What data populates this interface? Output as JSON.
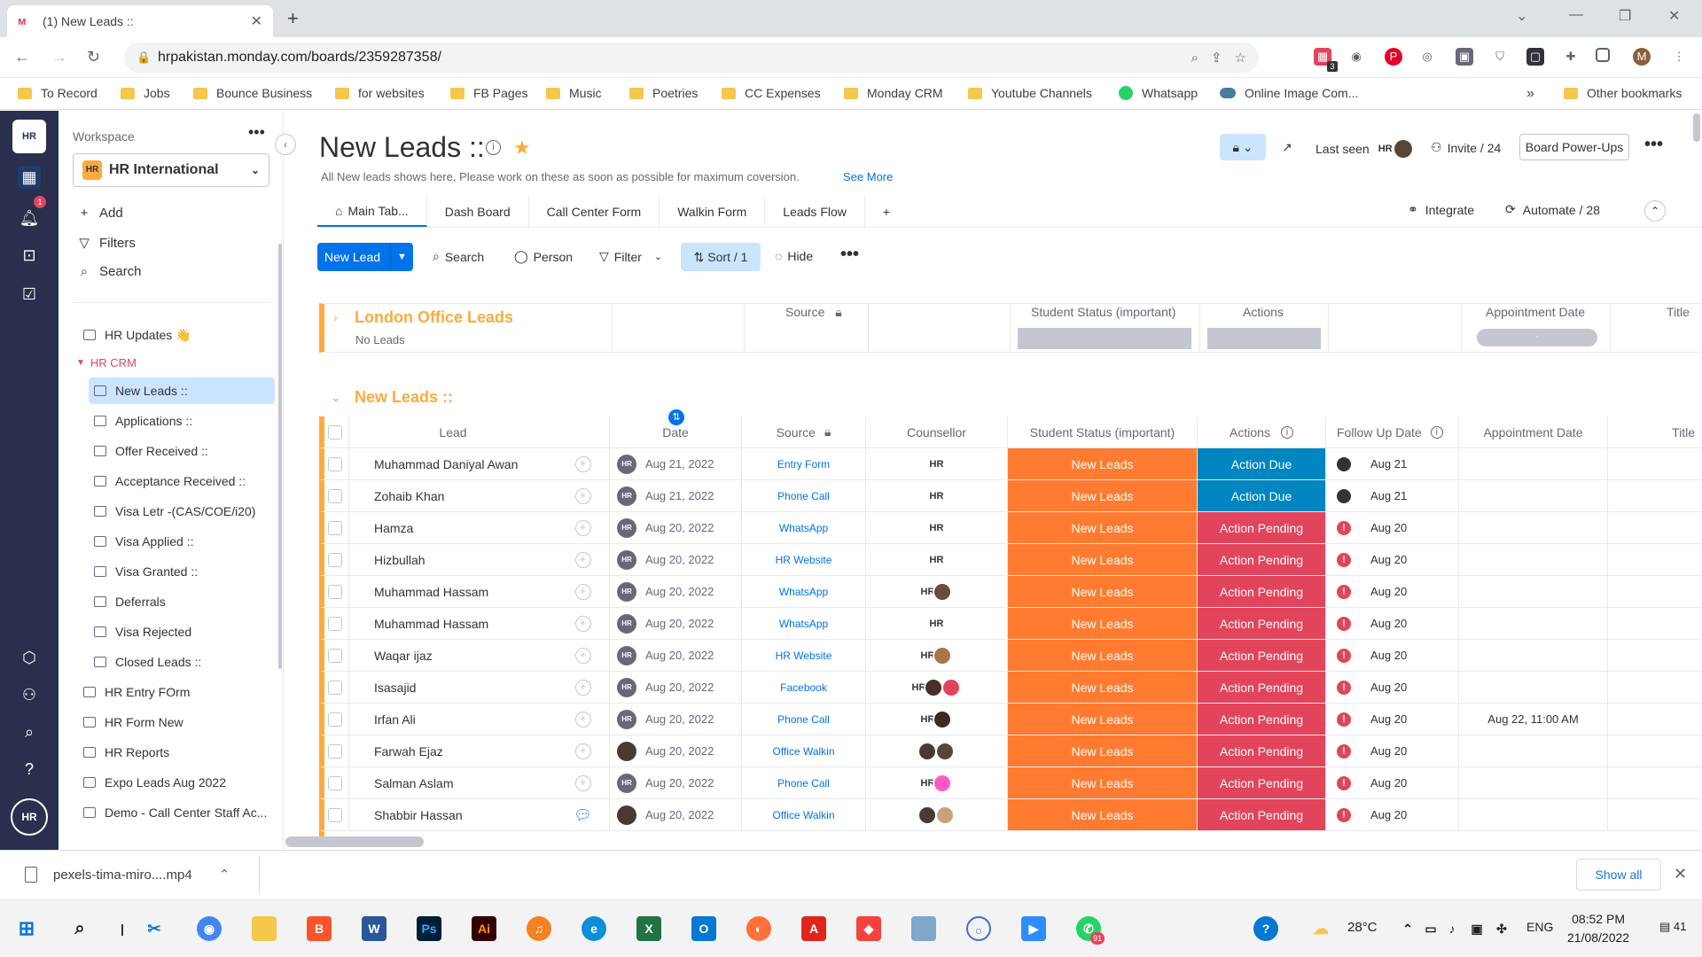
{
  "browser": {
    "tab_title": "(1) New Leads ::",
    "url": "hrpakistan.monday.com/boards/2359287358/",
    "bookmarks": [
      "To Record",
      "Jobs",
      "Bounce Business",
      "for websites",
      "FB Pages",
      "Music",
      "Poetries",
      "CC Expenses",
      "Monday CRM",
      "Youtube Channels",
      "Whatsapp",
      "Online Image Com...",
      "Other bookmarks"
    ],
    "ext_badge": "3"
  },
  "rail": {
    "notif_count": "1"
  },
  "sidebar": {
    "workspace_label": "Workspace",
    "workspace_name": "HR International",
    "workspace_badge": "HR",
    "add": "Add",
    "filters": "Filters",
    "search": "Search",
    "items": [
      {
        "label": "HR Updates 👋"
      },
      {
        "label": "HR CRM"
      },
      {
        "label": "New Leads ::"
      },
      {
        "label": "Applications ::"
      },
      {
        "label": "Offer Received ::"
      },
      {
        "label": "Acceptance Received ::"
      },
      {
        "label": "Visa Letr -(CAS/COE/i20)"
      },
      {
        "label": "Visa Applied ::"
      },
      {
        "label": "Visa Granted ::"
      },
      {
        "label": "Deferrals"
      },
      {
        "label": "Visa Rejected"
      },
      {
        "label": "Closed Leads ::"
      },
      {
        "label": "HR Entry FOrm"
      },
      {
        "label": "HR Form New"
      },
      {
        "label": "HR Reports"
      },
      {
        "label": "Expo Leads Aug 2022"
      },
      {
        "label": "Demo - Call Center Staff Ac..."
      }
    ]
  },
  "board": {
    "title": "New Leads ::",
    "description": "All New leads shows here, Please work on these as soon as possible for maximum coversion.",
    "see_more": "See More",
    "last_seen": "Last seen",
    "invite": "Invite / 24",
    "powerups": "Board Power-Ups",
    "views": [
      "Main Tab...",
      "Dash Board",
      "Call Center Form",
      "Walkin Form",
      "Leads Flow"
    ],
    "integrate": "Integrate",
    "automate": "Automate / 28"
  },
  "toolbar": {
    "new_lead": "New Lead",
    "search": "Search",
    "person": "Person",
    "filter": "Filter",
    "sort": "Sort / 1",
    "hide": "Hide"
  },
  "group1": {
    "title": "London Office Leads",
    "subtitle": "No Leads",
    "columns": {
      "source": "Source",
      "status": "Student Status (important)",
      "actions": "Actions",
      "appointment": "Appointment Date",
      "title": "Title"
    },
    "appointment_placeholder": "-"
  },
  "group2": {
    "title": "New Leads ::",
    "columns": {
      "lead": "Lead",
      "date": "Date",
      "source": "Source",
      "counsellor": "Counsellor",
      "status": "Student Status (important)",
      "actions": "Actions",
      "followup": "Follow Up Date",
      "appointment": "Appointment Date",
      "title": "Title"
    }
  },
  "colors": {
    "status_new": "#ff7b31",
    "action_due": "#0086c0",
    "action_pending": "#e2445c",
    "group_accent": "#fdab3d"
  },
  "rows": [
    {
      "lead": "Muhammad Daniyal Awan",
      "date": "Aug 21, 2022",
      "source": "Entry Form",
      "counsellor": "HR",
      "status": "New Leads",
      "action": "Action Due",
      "followup": "Aug 21",
      "appointment": ""
    },
    {
      "lead": "Zohaib Khan",
      "date": "Aug 21, 2022",
      "source": "Phone Call",
      "counsellor": "HR",
      "status": "New Leads",
      "action": "Action Due",
      "followup": "Aug 21",
      "appointment": ""
    },
    {
      "lead": "Hamza",
      "date": "Aug 20, 2022",
      "source": "WhatsApp",
      "counsellor": "HR",
      "status": "New Leads",
      "action": "Action Pending",
      "followup": "Aug 20",
      "appointment": ""
    },
    {
      "lead": "Hizbullah",
      "date": "Aug 20, 2022",
      "source": "HR Website",
      "counsellor": "HR",
      "status": "New Leads",
      "action": "Action Pending",
      "followup": "Aug 20",
      "appointment": ""
    },
    {
      "lead": "Muhammad Hassam",
      "date": "Aug 20, 2022",
      "source": "WhatsApp",
      "counsellor": "HR",
      "status": "New Leads",
      "action": "Action Pending",
      "followup": "Aug 20",
      "appointment": ""
    },
    {
      "lead": "Muhammad Hassam",
      "date": "Aug 20, 2022",
      "source": "WhatsApp",
      "counsellor": "HR",
      "status": "New Leads",
      "action": "Action Pending",
      "followup": "Aug 20",
      "appointment": ""
    },
    {
      "lead": "Waqar ijaz",
      "date": "Aug 20, 2022",
      "source": "HR Website",
      "counsellor": "HR",
      "status": "New Leads",
      "action": "Action Pending",
      "followup": "Aug 20",
      "appointment": ""
    },
    {
      "lead": "Isasajid",
      "date": "Aug 20, 2022",
      "source": "Facebook",
      "counsellor": "HR",
      "status": "New Leads",
      "action": "Action Pending",
      "followup": "Aug 20",
      "appointment": ""
    },
    {
      "lead": "Irfan Ali",
      "date": "Aug 20, 2022",
      "source": "Phone Call",
      "counsellor": "HR",
      "status": "New Leads",
      "action": "Action Pending",
      "followup": "Aug 20",
      "appointment": "Aug 22, 11:00 AM"
    },
    {
      "lead": "Farwah Ejaz",
      "date": "Aug 20, 2022",
      "source": "Office Walkin",
      "counsellor": "",
      "status": "New Leads",
      "action": "Action Pending",
      "followup": "Aug 20",
      "appointment": ""
    },
    {
      "lead": "Salman Aslam",
      "date": "Aug 20, 2022",
      "source": "Phone Call",
      "counsellor": "HR",
      "status": "New Leads",
      "action": "Action Pending",
      "followup": "Aug 20",
      "appointment": ""
    },
    {
      "lead": "Shabbir Hassan",
      "date": "Aug 20, 2022",
      "source": "Office Walkin",
      "counsellor": "",
      "status": "New Leads",
      "action": "Action Pending",
      "followup": "Aug 20",
      "appointment": ""
    }
  ],
  "downloads": {
    "file": "pexels-tima-miro....mp4",
    "show_all": "Show all"
  },
  "taskbar": {
    "temp": "28°C",
    "lang": "ENG",
    "time": "08:52 PM",
    "date": "21/08/2022",
    "notif": "41",
    "whatsapp_badge": "91"
  }
}
